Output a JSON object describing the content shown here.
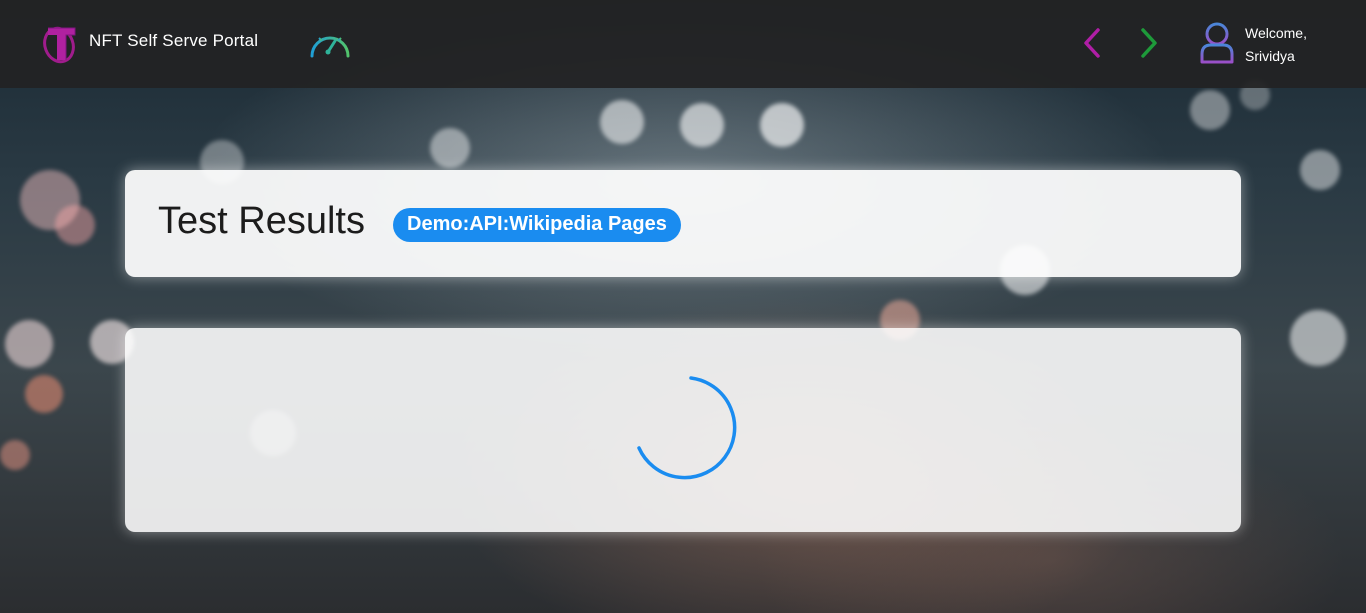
{
  "header": {
    "app_title": "NFT Self Serve Portal",
    "welcome_line1": "Welcome,",
    "welcome_line2": "Srividya",
    "icons": {
      "logo": "telstra-logo-icon",
      "dashboard": "speedometer-icon",
      "back": "chevron-left-icon",
      "forward": "chevron-right-icon",
      "user": "user-icon"
    }
  },
  "main": {
    "page_title": "Test Results",
    "test_badge": "Demo:API:Wikipedia Pages",
    "results_state": "loading"
  },
  "colors": {
    "badge_bg": "#1a8cf0",
    "spinner": "#1a8cf0",
    "back_arrow": "#b01ea6",
    "forward_arrow": "#1e9a3a",
    "topbar_bg": "#222224"
  }
}
